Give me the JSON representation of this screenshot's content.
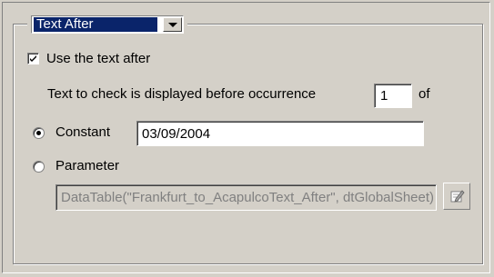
{
  "combo": {
    "selected": "Text After"
  },
  "use_text_after": {
    "label": "Use the text after",
    "checked": true
  },
  "occurrence": {
    "prefix_label": "Text to check is displayed before occurrence",
    "value": "1",
    "suffix_label": "of"
  },
  "constant": {
    "label": "Constant",
    "selected": true,
    "value": "03/09/2004"
  },
  "parameter": {
    "label": "Parameter",
    "selected": false,
    "value": "DataTable(\"Frankfurt_to_AcapulcoText_After\", dtGlobalSheet)"
  },
  "icons": {
    "combo_arrow": "chevron-down-icon",
    "checkbox_mark": "checkmark-icon",
    "parameter_button": "edit-icon"
  }
}
